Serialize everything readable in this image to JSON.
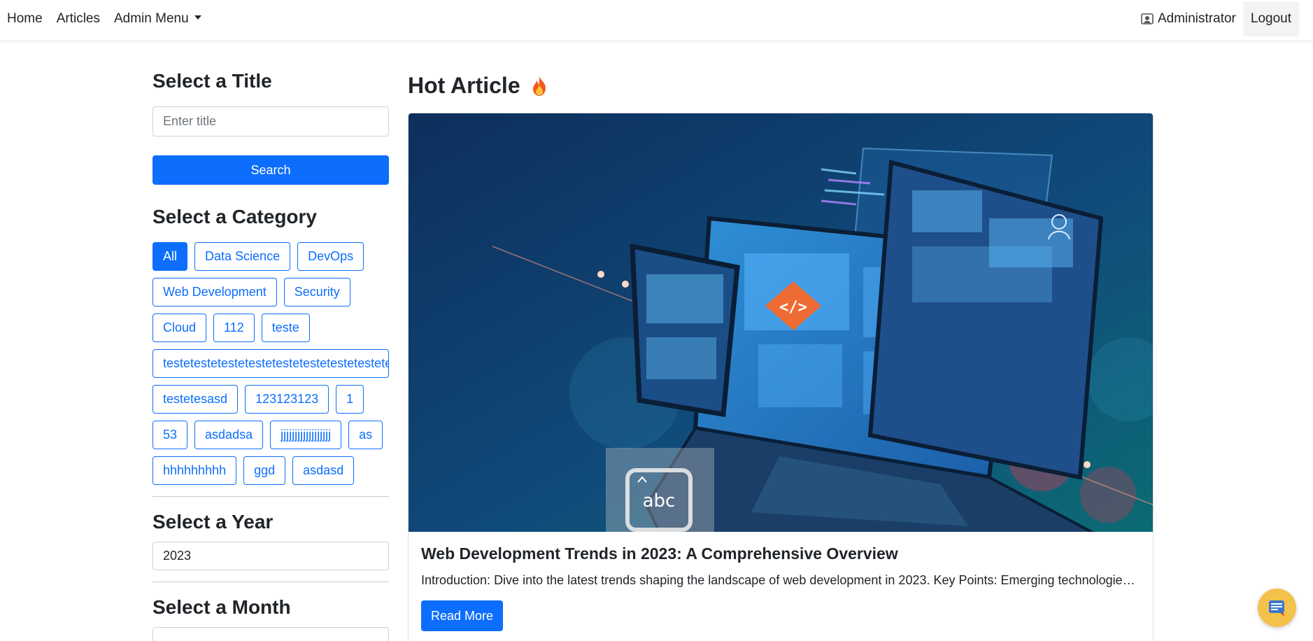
{
  "navbar": {
    "links": [
      {
        "label": "Home"
      },
      {
        "label": "Articles"
      },
      {
        "label": "Admin Menu"
      }
    ],
    "user_label": "Administrator",
    "logout_label": "Logout"
  },
  "sidebar": {
    "title_heading": "Select a Title",
    "title_placeholder": "Enter title",
    "search_label": "Search",
    "category_heading": "Select a Category",
    "categories": [
      [
        "All",
        "Data Science",
        "DevOps"
      ],
      [
        "Web Development",
        "Security"
      ],
      [
        "Cloud",
        "112",
        "teste"
      ],
      [
        "testetestetestetestetestetestetestetestetestetestetestetestetestetestetestetestetestetestetestetestetestetestetestetestetestetestetestetestetestetestetestetestetesteteste"
      ],
      [
        "testetesasd",
        "123123123",
        "1"
      ],
      [
        "53",
        "asdadsa",
        "jjjjjjjjjjjjjjjjjj",
        "as"
      ],
      [
        "hhhhhhhhh",
        "ggd",
        "asdasd"
      ]
    ],
    "active_category": "All",
    "year_heading": "Select a Year",
    "year_value": "2023",
    "month_heading": "Select a Month"
  },
  "main": {
    "hot_heading": "Hot Article",
    "article": {
      "title": "Web Development Trends in 2023: A Comprehensive Overview",
      "excerpt": "Introduction: Dive into the latest trends shaping the landscape of web development in 2023. Key Points: Emerging technologies ...",
      "read_more_label": "Read More",
      "image_overlay_text": "abc"
    }
  },
  "colors": {
    "primary": "#0d6efd",
    "fab": "#f4c24a",
    "hero_bg": "#0f3d6b"
  },
  "icons": [
    "user-badge-icon",
    "fire-icon",
    "chat-widget-icon",
    "dropdown-caret-icon"
  ]
}
